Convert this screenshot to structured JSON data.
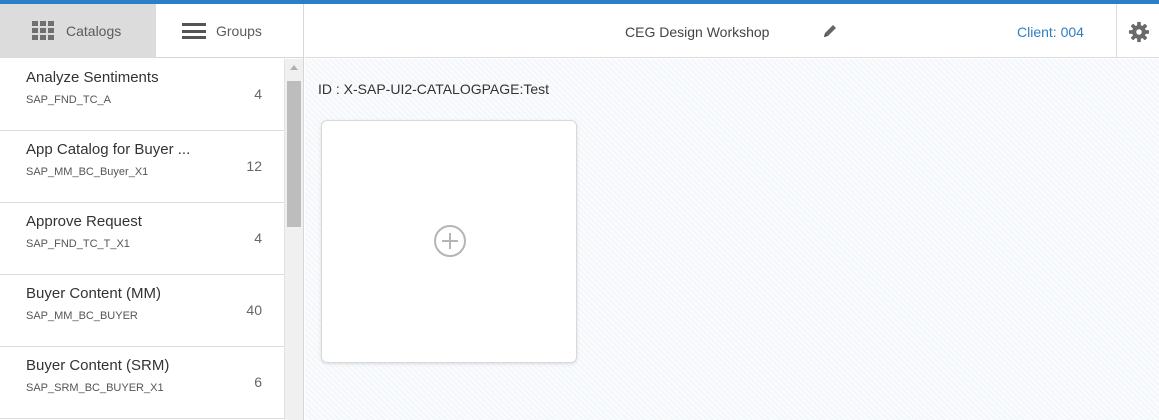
{
  "sidebar": {
    "tabs": {
      "catalogs_label": "Catalogs",
      "groups_label": "Groups"
    },
    "items": [
      {
        "title": "Analyze Sentiments",
        "id": "SAP_FND_TC_A",
        "count": "4"
      },
      {
        "title": "App Catalog for Buyer ...",
        "id": "SAP_MM_BC_Buyer_X1",
        "count": "12"
      },
      {
        "title": "Approve Request",
        "id": "SAP_FND_TC_T_X1",
        "count": "4"
      },
      {
        "title": "Buyer Content (MM)",
        "id": "SAP_MM_BC_BUYER",
        "count": "40"
      },
      {
        "title": "Buyer Content (SRM)",
        "id": "SAP_SRM_BC_BUYER_X1",
        "count": "6"
      }
    ]
  },
  "header": {
    "title": "CEG Design Workshop",
    "client_label": "Client: 004",
    "icons": [
      "pencil-icon",
      "gear-icon"
    ]
  },
  "main": {
    "page_id": "ID : X-SAP-UI2-CATALOGPAGE:Test",
    "add_tile_icon": "plus-circle-icon"
  },
  "colors": {
    "accent": "#2b7fc6",
    "link": "#2f7ec2",
    "active_tab_bg": "#dcdcdc"
  }
}
